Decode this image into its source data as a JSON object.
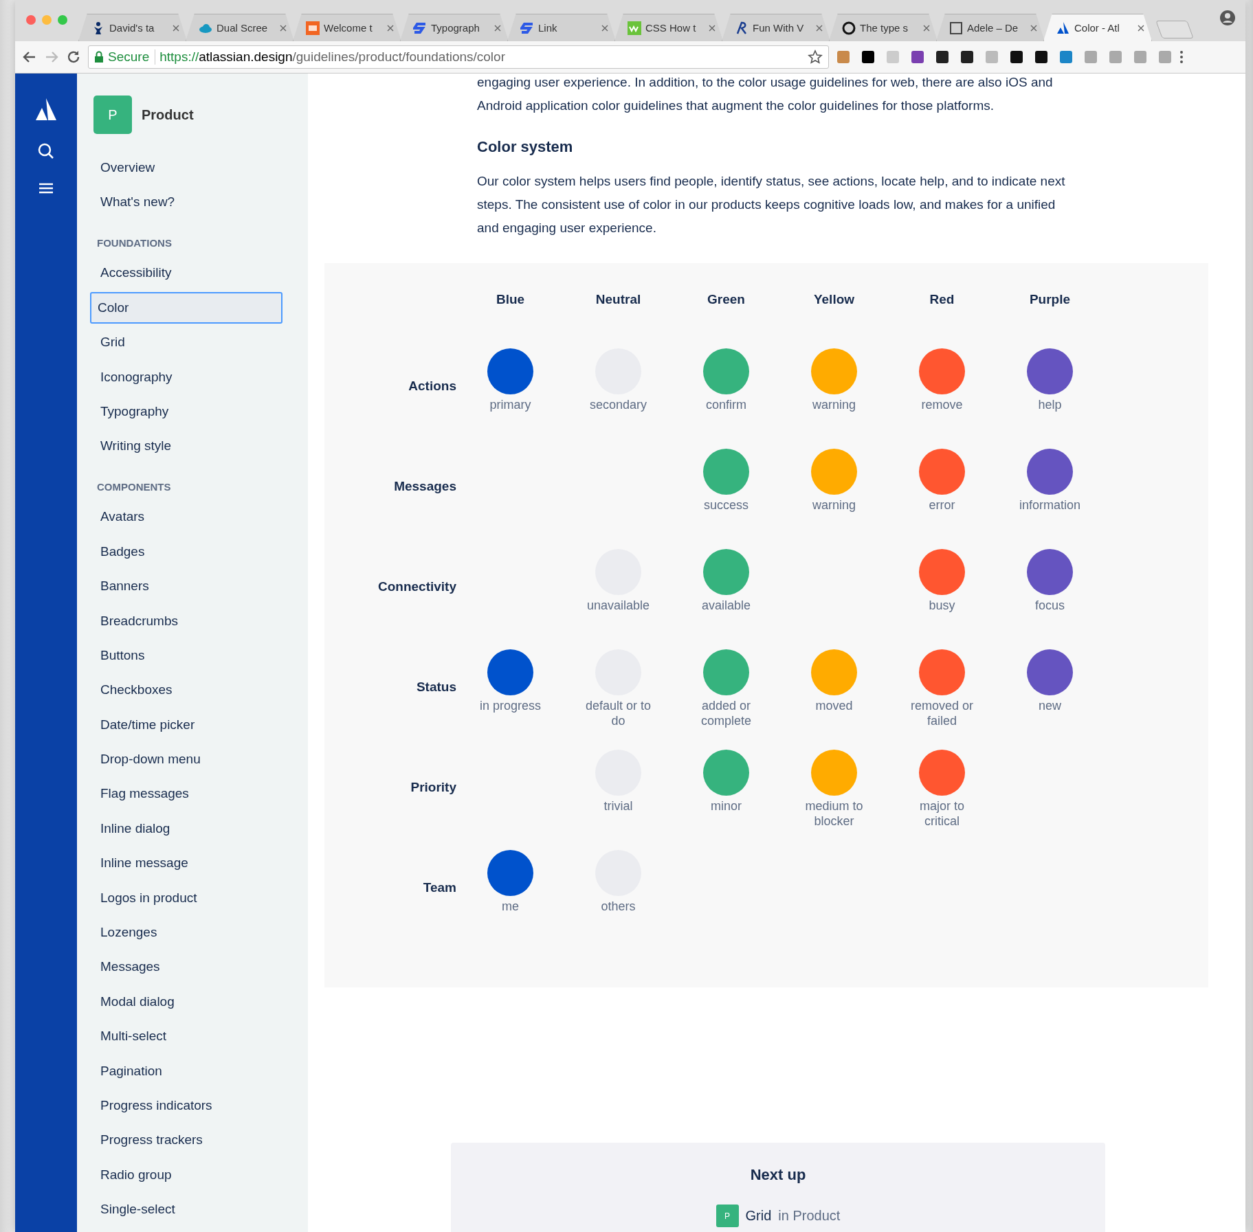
{
  "browser": {
    "tabs": [
      {
        "title": "David's ta",
        "selected": false
      },
      {
        "title": "Dual Scree",
        "selected": false
      },
      {
        "title": "Welcome t",
        "selected": false
      },
      {
        "title": "Typograph",
        "selected": false
      },
      {
        "title": "Link",
        "selected": false
      },
      {
        "title": "CSS How t",
        "selected": false
      },
      {
        "title": "Fun With V",
        "selected": false
      },
      {
        "title": "The type s",
        "selected": false
      },
      {
        "title": "Adele – De",
        "selected": false
      },
      {
        "title": "Color - Atl",
        "selected": true
      }
    ],
    "address": {
      "secure_label": "Secure",
      "scheme": "https://",
      "host": "atlassian.design",
      "path": "/guidelines/product/foundations/color"
    }
  },
  "sidebar": {
    "product": {
      "badge": "P",
      "name": "Product"
    },
    "top_items": [
      {
        "label": "Overview",
        "selected": false
      },
      {
        "label": "What's new?",
        "selected": false
      }
    ],
    "sections": [
      {
        "heading": "FOUNDATIONS",
        "items": [
          {
            "label": "Accessibility",
            "selected": false
          },
          {
            "label": "Color",
            "selected": true
          },
          {
            "label": "Grid",
            "selected": false
          },
          {
            "label": "Iconography",
            "selected": false
          },
          {
            "label": "Typography",
            "selected": false
          },
          {
            "label": "Writing style",
            "selected": false
          }
        ]
      },
      {
        "heading": "COMPONENTS",
        "items": [
          {
            "label": "Avatars",
            "selected": false
          },
          {
            "label": "Badges",
            "selected": false
          },
          {
            "label": "Banners",
            "selected": false
          },
          {
            "label": "Breadcrumbs",
            "selected": false
          },
          {
            "label": "Buttons",
            "selected": false
          },
          {
            "label": "Checkboxes",
            "selected": false
          },
          {
            "label": "Date/time picker",
            "selected": false
          },
          {
            "label": "Drop-down menu",
            "selected": false
          },
          {
            "label": "Flag messages",
            "selected": false
          },
          {
            "label": "Inline dialog",
            "selected": false
          },
          {
            "label": "Inline message",
            "selected": false
          },
          {
            "label": "Logos in product",
            "selected": false
          },
          {
            "label": "Lozenges",
            "selected": false
          },
          {
            "label": "Messages",
            "selected": false
          },
          {
            "label": "Modal dialog",
            "selected": false
          },
          {
            "label": "Multi-select",
            "selected": false
          },
          {
            "label": "Pagination",
            "selected": false
          },
          {
            "label": "Progress indicators",
            "selected": false
          },
          {
            "label": "Progress trackers",
            "selected": false
          },
          {
            "label": "Radio group",
            "selected": false
          },
          {
            "label": "Single-select",
            "selected": false
          }
        ]
      }
    ]
  },
  "content": {
    "intro": "engaging user experience. In addition, to the color usage guidelines for web, there are also iOS and Android application color guidelines that augment the color guidelines for those platforms.",
    "heading": "Color system",
    "paragraph": "Our color system helps users find people, identify status, see actions, locate help, and to indicate next steps. The consistent use of color in our products keeps cognitive loads low, and makes for a unified and engaging user experience.",
    "color_table": {
      "columns": [
        "Blue",
        "Neutral",
        "Green",
        "Yellow",
        "Red",
        "Purple"
      ],
      "rows": [
        {
          "label": "Actions",
          "cells": [
            {
              "kind": "swatch",
              "color": "#0052cc",
              "label": "primary"
            },
            {
              "kind": "swatch",
              "color": "#ebecf0",
              "label": "secondary"
            },
            {
              "kind": "swatch",
              "color": "#36b37e",
              "label": "confirm"
            },
            {
              "kind": "swatch",
              "color": "#ffab00",
              "label": "warning"
            },
            {
              "kind": "swatch",
              "color": "#ff5630",
              "label": "remove"
            },
            {
              "kind": "swatch",
              "color": "#6554c0",
              "label": "help"
            }
          ]
        },
        {
          "label": "Messages",
          "cells": [
            {
              "kind": "empty"
            },
            {
              "kind": "empty"
            },
            {
              "kind": "swatch",
              "color": "#36b37e",
              "label": "success"
            },
            {
              "kind": "swatch",
              "color": "#ffab00",
              "label": "warning"
            },
            {
              "kind": "swatch",
              "color": "#ff5630",
              "label": "error"
            },
            {
              "kind": "swatch",
              "color": "#6554c0",
              "label": "information"
            }
          ]
        },
        {
          "label": "Connectivity",
          "cells": [
            {
              "kind": "empty"
            },
            {
              "kind": "swatch",
              "color": "#ebecf0",
              "label": "unavailable"
            },
            {
              "kind": "swatch",
              "color": "#36b37e",
              "label": "available"
            },
            {
              "kind": "empty"
            },
            {
              "kind": "swatch",
              "color": "#ff5630",
              "label": "busy"
            },
            {
              "kind": "swatch",
              "color": "#6554c0",
              "label": "focus"
            }
          ]
        },
        {
          "label": "Status",
          "cells": [
            {
              "kind": "swatch",
              "color": "#0052cc",
              "label": "in progress"
            },
            {
              "kind": "swatch",
              "color": "#ebecf0",
              "label": "default or to do"
            },
            {
              "kind": "swatch",
              "color": "#36b37e",
              "label": "added or complete"
            },
            {
              "kind": "swatch",
              "color": "#ffab00",
              "label": "moved"
            },
            {
              "kind": "swatch",
              "color": "#ff5630",
              "label": "removed or failed"
            },
            {
              "kind": "swatch",
              "color": "#6554c0",
              "label": "new"
            }
          ]
        },
        {
          "label": "Priority",
          "cells": [
            {
              "kind": "empty"
            },
            {
              "kind": "swatch",
              "color": "#ebecf0",
              "label": "trivial"
            },
            {
              "kind": "swatch",
              "color": "#36b37e",
              "label": "minor"
            },
            {
              "kind": "swatch",
              "color": "#ffab00",
              "label": "medium to blocker"
            },
            {
              "kind": "swatch",
              "color": "#ff5630",
              "label": "major to critical"
            },
            {
              "kind": "empty"
            }
          ]
        },
        {
          "label": "Team",
          "cells": [
            {
              "kind": "swatch",
              "color": "#0052cc",
              "label": "me"
            },
            {
              "kind": "swatch",
              "color": "#ebecf0",
              "label": "others"
            },
            {
              "kind": "empty"
            },
            {
              "kind": "empty"
            },
            {
              "kind": "empty"
            },
            {
              "kind": "empty"
            }
          ]
        }
      ]
    },
    "next_up": {
      "heading": "Next up",
      "badge": "P",
      "page": "Grid",
      "context": "in Product"
    }
  }
}
